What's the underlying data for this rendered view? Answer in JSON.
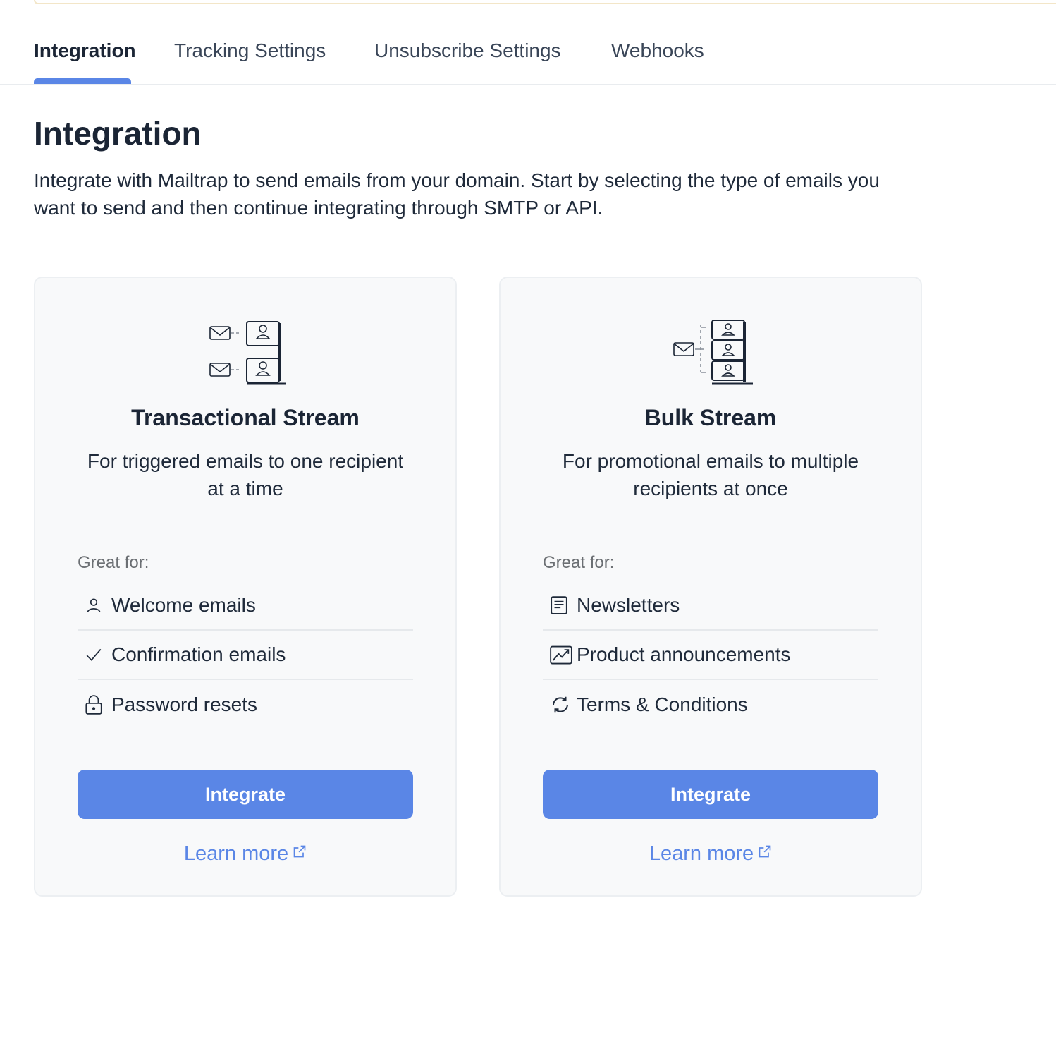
{
  "tabs": [
    {
      "label": "Integration",
      "active": true
    },
    {
      "label": "Tracking Settings",
      "active": false
    },
    {
      "label": "Unsubscribe Settings",
      "active": false
    },
    {
      "label": "Webhooks",
      "active": false
    }
  ],
  "page": {
    "title": "Integration",
    "description": "Integrate with Mailtrap to send emails from your domain. Start by selecting the type of emails you want to send and then continue integrating through SMTP or API."
  },
  "cards": [
    {
      "title": "Transactional Stream",
      "description": "For triggered emails to one recipient at a time",
      "great_for_label": "Great for:",
      "features": [
        {
          "icon": "user-icon",
          "label": "Welcome emails"
        },
        {
          "icon": "check-icon",
          "label": "Confirmation emails"
        },
        {
          "icon": "lock-icon",
          "label": "Password resets"
        }
      ],
      "button_label": "Integrate",
      "link_label": "Learn more",
      "illustration": "transactional-stream-icon"
    },
    {
      "title": "Bulk Stream",
      "description": "For promotional emails to multiple recipients at once",
      "great_for_label": "Great for:",
      "features": [
        {
          "icon": "newsletter-icon",
          "label": "Newsletters"
        },
        {
          "icon": "chart-up-icon",
          "label": "Product announcements"
        },
        {
          "icon": "refresh-icon",
          "label": "Terms & Conditions"
        }
      ],
      "button_label": "Integrate",
      "link_label": "Learn more",
      "illustration": "bulk-stream-icon"
    }
  ],
  "colors": {
    "accent": "#5a86e6",
    "text": "#1f2a3a",
    "card_bg": "#f8f9fa"
  }
}
